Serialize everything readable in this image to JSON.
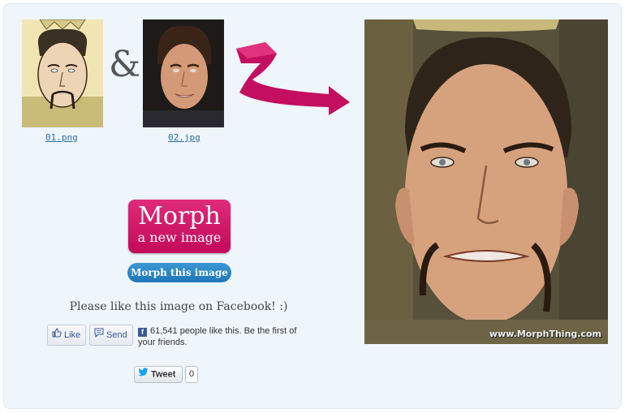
{
  "source_images": [
    {
      "filename": "01.png"
    },
    {
      "filename": "02.jpg"
    }
  ],
  "ampersand": "&",
  "result": {
    "watermark": "www.MorphThing.com"
  },
  "morph_button": {
    "line1": "Morph",
    "line2": "a new image"
  },
  "morph_this_button": "Morph this image",
  "facebook": {
    "prompt": "Please like this image on Facebook! :)",
    "like_label": "Like",
    "send_label": "Send",
    "count_text": "61,541 people like this. Be the first of your friends."
  },
  "twitter": {
    "tweet_label": "Tweet",
    "count": "0"
  },
  "colors": {
    "accent_pink": "#d0126a",
    "accent_blue": "#2a86c6",
    "panel_bg": "#eef5fb"
  }
}
